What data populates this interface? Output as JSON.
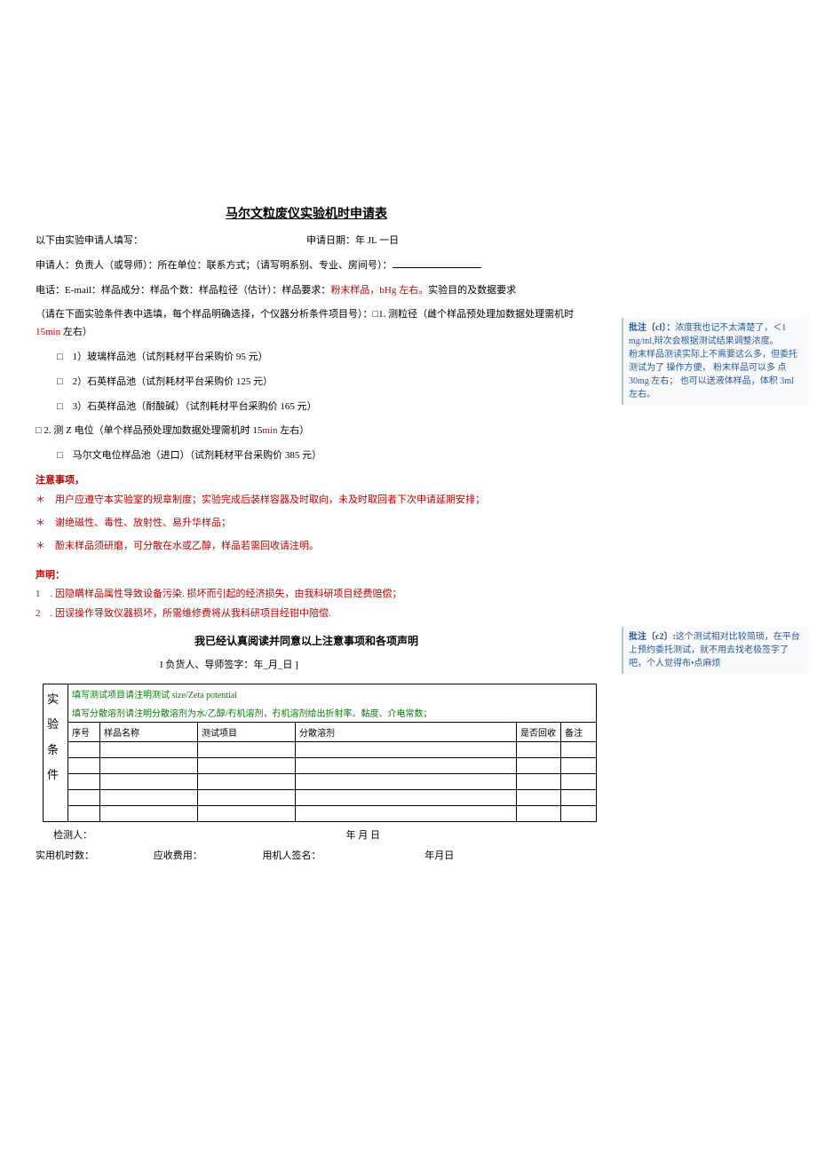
{
  "title": "马尔文粒废仪实验机时申请表",
  "header": {
    "filled_by": "以下由实验申请人填写：",
    "apply_date_label": "申请日期：年 JL 一日"
  },
  "line1": "申请人：负责人（或导师）：所在单位：联系方式；（请写明系别、专业、房间号）：",
  "line2_a": "电话：E-mail：样品成分：样品个数：样品粒径（估计）：样品要求：",
  "line2_b": "粉末样品，bHg 左右。",
  "line2_c": "实验目的及数据要求",
  "line3": "（请在下面实验条件表中选填，每个样品明确选择，个仪器分析条件项目号）：□1. 测粒径（雌个样品预处理加数据处理需机时 ",
  "line3_time": "15min",
  "line3_tail": " 左右）",
  "opt1": "□　1）玻璃样品池（试剂耗材平台采购价 95 元）",
  "opt2": "□　2）石英样品池（试剂耗材平台采购价 125 元）",
  "opt3": "□　3）石英样品池（耐酸碱）（试剂耗材平台采购价 165 元）",
  "line4a": "□ 2. 测 Z 电位（单个样品预处理加数据处理需机时 15",
  "line4b": "min",
  "line4c": " 左右）",
  "opt4": "□　马尔文电位样品池（进口）（试剂耗材平台采购价 385 元）",
  "notice_title": "注意事项，",
  "notice1": "＊　用户应遵守本实验室的规章制度；实验完成后装样容器及时取向，未及时取回者下次申请延期安排；",
  "notice2": "＊　谢绝磁性、毒性、放射性、易升华样品；",
  "notice3": "＊　酚末样品须研磨，可分散在水或乙醇，样品若需回收请注明。",
  "decl_title": "声明：",
  "decl1": "1　. 因隐瞒样品属性导致设备污染. 损坏而引起的经济损失，由我科研项目经费赔偿；",
  "decl2": "2　. 因误操作导致仪器损坏，所需维修费将从我科研项目经钳中陪偿.",
  "agree": "我已经认真阅读并同意以上注意事项和各项声明",
  "sign": "I 负货人、导师签字：年_月_日 ]",
  "table": {
    "vertical_label": "实\n验\n条\n件",
    "hint1": "填写测试项目请注明测试 size/Zeta potential",
    "hint2": "填写分散溶剂请注明分散溶剂为水/乙醇/冇机溶剂，冇机溶剂给出折射率、黏度、介电常数；",
    "headers": [
      "序号",
      "样品名称",
      "测试项目",
      "分散溶剂",
      "是否回收",
      "备注"
    ]
  },
  "footer": {
    "inspector": "检测人：",
    "date1": "年 月 日",
    "hours": "实用机时数：",
    "fee": "应收费用：",
    "signer": "用机人签名：",
    "date2": "年月日"
  },
  "comments": {
    "c1": {
      "label": "批注〔cl〕：",
      "text": "浓度我也记不太清楚了，＜1 mg/ml,辩次会根据测试结果调整浓度。\n粉末样品测读实际上不需要这么多，但委托测试为了 操作方便， 粉末样品可以多 点 30mg 左右；   也可以送液体样品，体积 3ml 左右。"
    },
    "c2": {
      "label": "批注〔c2〕:",
      "text": "这个测试相对比较简琐，在平台上预约委托测试，就不用去找老极签字了吧，个人觉得布•点麻烦"
    }
  }
}
